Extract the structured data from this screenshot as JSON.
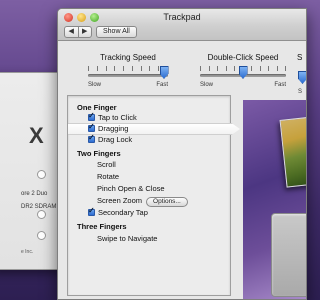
{
  "background_window": {
    "title_fragment": "X",
    "line1": "ore 2 Duo",
    "line2": "DR2 SDRAM",
    "line3": "e Inc."
  },
  "window": {
    "title": "Trackpad",
    "nav_back": "◀",
    "nav_forward": "▶",
    "show_all": "Show All"
  },
  "sliders": {
    "tracking": {
      "title": "Tracking Speed",
      "min_label": "Slow",
      "max_label": "Fast",
      "value": 0.95
    },
    "double_click": {
      "title": "Double-Click Speed",
      "min_label": "Slow",
      "max_label": "Fast",
      "value": 0.5
    },
    "cut_off": {
      "title": "S",
      "min_label": "S"
    }
  },
  "gestures": {
    "one_finger": {
      "heading": "One Finger",
      "tap_to_click": "Tap to Click",
      "dragging": "Dragging",
      "drag_lock": "Drag Lock"
    },
    "two_fingers": {
      "heading": "Two Fingers",
      "scroll": "Scroll",
      "rotate": "Rotate",
      "pinch": "Pinch Open & Close",
      "screen_zoom": "Screen Zoom",
      "options_button": "Options...",
      "secondary_tap": "Secondary Tap"
    },
    "three_fingers": {
      "heading": "Three Fingers",
      "swipe": "Swipe to Navigate"
    }
  },
  "colors": {
    "accent": "#2d6bd0",
    "desktop": "#5a3f86"
  }
}
